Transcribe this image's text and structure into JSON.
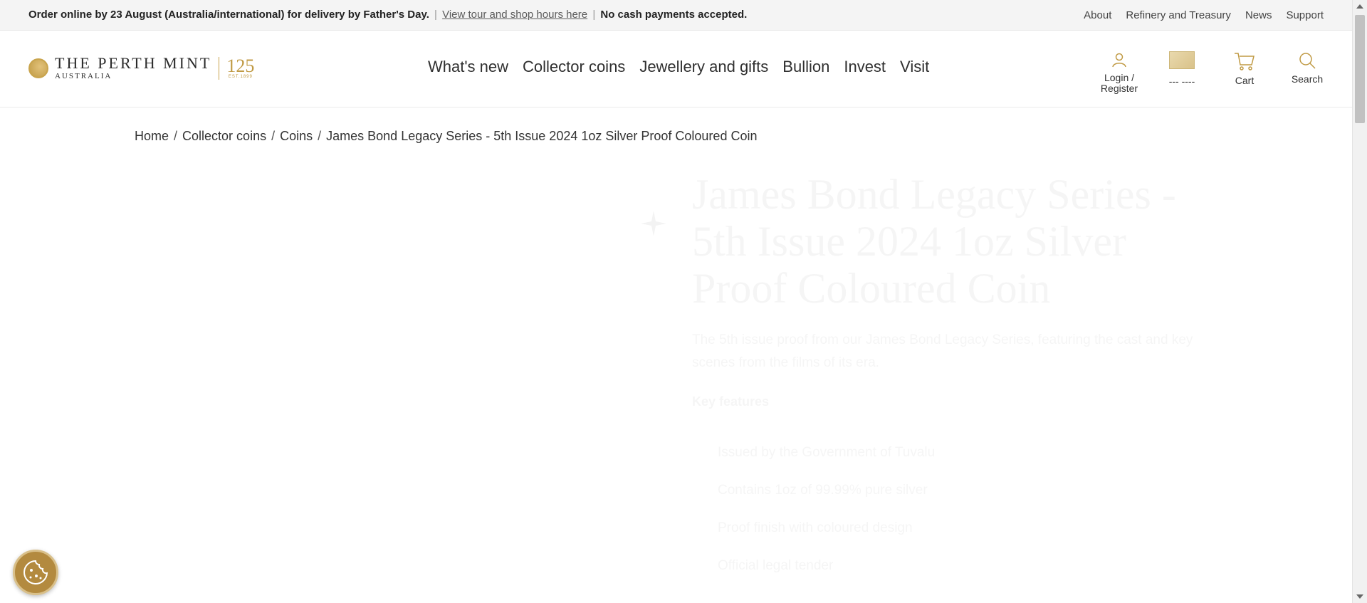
{
  "topbar": {
    "announce_bold": "Order online by 23 August (Australia/international) for delivery by Father's Day.",
    "announce_link": "View tour and shop hours here",
    "announce_tail": "No cash payments accepted.",
    "util_links": [
      "About",
      "Refinery and Treasury",
      "News",
      "Support"
    ]
  },
  "header": {
    "logo_name": "THE PERTH MINT",
    "logo_sub": "AUSTRALIA",
    "logo_anniv": "125",
    "logo_est": "EST.1899",
    "nav": [
      "What's new",
      "Collector coins",
      "Jewellery and gifts",
      "Bullion",
      "Invest",
      "Visit"
    ],
    "login_label_1": "Login /",
    "login_label_2": "Register",
    "currency_label": "--- ----",
    "cart_label": "Cart",
    "search_label": "Search"
  },
  "breadcrumb": [
    "Home",
    "Collector coins",
    "Coins",
    "James Bond Legacy Series - 5th Issue 2024 1oz Silver Proof Coloured Coin"
  ],
  "product": {
    "title": "James Bond Legacy Series - 5th Issue 2024 1oz Silver Proof Coloured Coin",
    "description": "The 5th issue proof from our James Bond Legacy Series, featuring the cast and key scenes from the films of its era.",
    "key_features_label": "Key features",
    "features": [
      "Issued by the Government of Tuvalu",
      "Contains 1oz of 99.99% pure silver",
      "Proof finish with coloured design",
      "Official legal tender"
    ]
  },
  "colors": {
    "gold": "#c09a44",
    "topbar_bg": "#f4f4f4"
  }
}
